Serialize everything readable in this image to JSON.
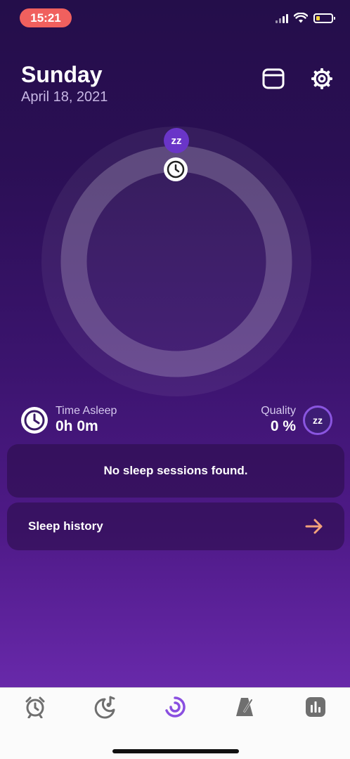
{
  "status_bar": {
    "time": "15:21",
    "battery_level": 0.25,
    "battery_color": "#f4d33b"
  },
  "header": {
    "day": "Sunday",
    "date": "April 18, 2021"
  },
  "ring": {
    "badge_text": "zz"
  },
  "stats": {
    "time_asleep_label": "Time Asleep",
    "time_asleep_value": "0h 0m",
    "quality_label": "Quality",
    "quality_value": "0 %",
    "quality_badge": "zz"
  },
  "cards": {
    "empty_message": "No sleep sessions found.",
    "history_label": "Sleep history",
    "history_arrow_color": "#f3a27a"
  },
  "tabs": [
    {
      "icon": "alarm-clock-icon"
    },
    {
      "icon": "moon-music-icon"
    },
    {
      "icon": "sleep-ring-icon",
      "active": true,
      "active_color": "#8a4fe0"
    },
    {
      "icon": "metronome-icon"
    },
    {
      "icon": "statistics-icon"
    }
  ],
  "colors": {
    "accent": "#6a35c8",
    "background_top": "#240e4a",
    "background_bottom": "#7330b5"
  }
}
